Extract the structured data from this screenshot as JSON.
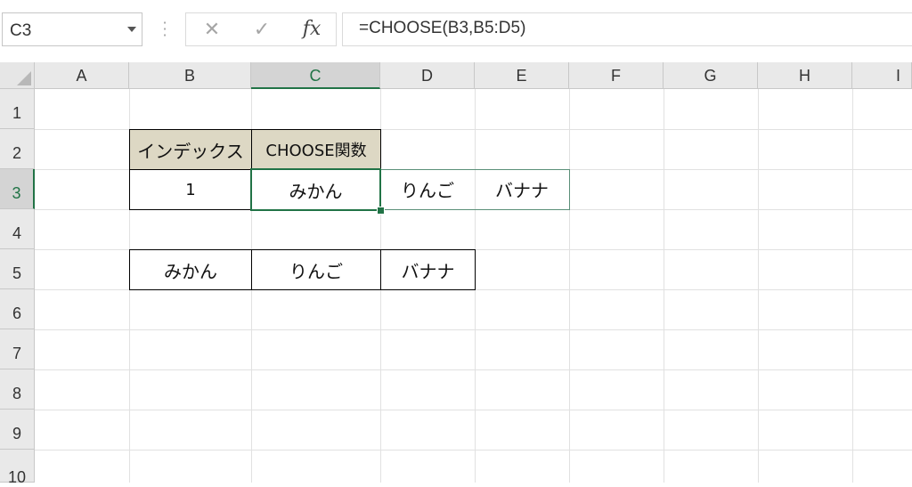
{
  "name_box": {
    "value": "C3"
  },
  "formula_bar": {
    "cancel_glyph": "✕",
    "enter_glyph": "✓",
    "fx_label": "fx",
    "formula": "=CHOOSE(B3,B5:D5)"
  },
  "columns": [
    "A",
    "B",
    "C",
    "D",
    "E",
    "F",
    "G",
    "H",
    "I"
  ],
  "rows": [
    "1",
    "2",
    "3",
    "4",
    "5",
    "6",
    "7",
    "8",
    "9",
    "10"
  ],
  "active_cell": {
    "column": "C",
    "row": "3"
  },
  "cells": {
    "B2": "インデックス",
    "C2": "CHOOSE関数",
    "B3": "1",
    "C3": "みかん",
    "D3": "りんご",
    "E3": "バナナ",
    "B5": "みかん",
    "C5": "りんご",
    "D5": "バナナ"
  },
  "colors": {
    "accent": "#217346",
    "header_fill": "#ddd8c4",
    "grid_line": "#e1e1e1"
  }
}
